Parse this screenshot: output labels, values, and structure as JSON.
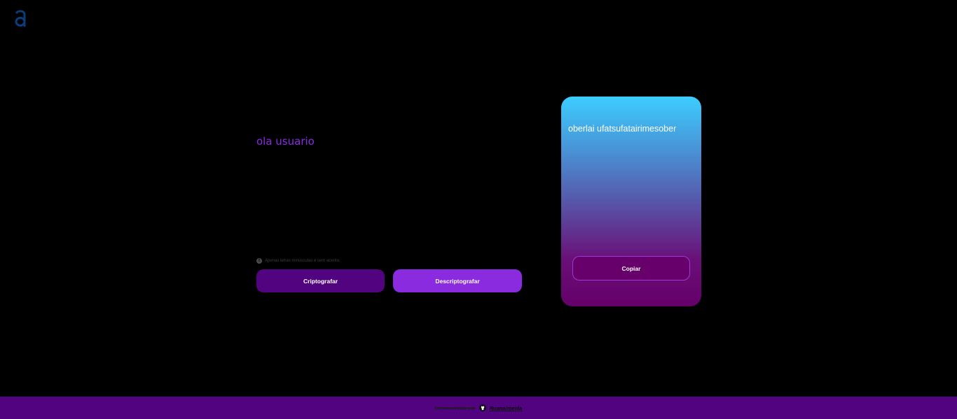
{
  "header": {
    "logo_icon": "alura-a-logo-icon",
    "logo_color": "#0a3d7a"
  },
  "input": {
    "value": "ola usuario",
    "text_color": "#8a2be2"
  },
  "hint": {
    "icon": "info-circle-icon",
    "text": "Apenas letras minúsculas e sem acento."
  },
  "actions": {
    "encrypt_label": "Criptografar",
    "decrypt_label": "Descriptografar",
    "encrypt_color": "#520480",
    "decrypt_color": "#8b2be0"
  },
  "result": {
    "text": "oberlai ufatsufatairimesober",
    "copy_label": "Copiar"
  },
  "footer": {
    "text": "Desenvolvido por",
    "icon": "github-icon",
    "link_text": "Ruanalmeida",
    "background": "#520480"
  }
}
